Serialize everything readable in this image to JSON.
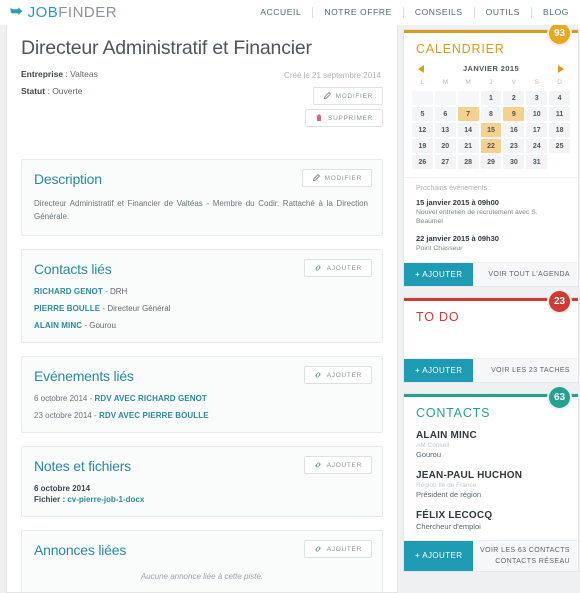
{
  "header": {
    "logo": {
      "mark_icon": "swoosh-icon",
      "part1": "JOB",
      "part2": "FINDER"
    },
    "nav": [
      {
        "label": "ACCUEIL"
      },
      {
        "label": "NOTRE OFFRE"
      },
      {
        "label": "CONSEILS"
      },
      {
        "label": "OUTILS"
      },
      {
        "label": "BLOG"
      }
    ]
  },
  "job": {
    "title": "Directeur Administratif et Financier",
    "entreprise_label": "Entreprise",
    "entreprise_value": "Valteas",
    "statut_label": "Statut",
    "statut_value": "Ouverte",
    "created": "Créé le 21 septembre 2014",
    "edit_button": "MODIFIER",
    "delete_button": "SUPPRIMER",
    "edit_icon": "pencil-icon",
    "delete_icon": "trash-icon"
  },
  "panels": {
    "description": {
      "title": "Description",
      "button": "MODIFIER",
      "button_icon": "pencil-icon",
      "text": "Directeur Administratif et Financier de Valtéas - Membre du Codir. Rattaché à la Direction Générale."
    },
    "contacts": {
      "title": "Contacts liés",
      "button": "AJOUTER",
      "button_icon": "link-icon",
      "items": [
        {
          "name": "RICHARD GENOT",
          "role": "DRH"
        },
        {
          "name": "PIERRE BOULLE",
          "role": "Directeur Général"
        },
        {
          "name": "ALAIN MINC",
          "role": "Gourou"
        }
      ]
    },
    "events": {
      "title": "Evénements liés",
      "button": "AJOUTER",
      "button_icon": "link-icon",
      "items": [
        {
          "date": "6 octobre 2014",
          "label": "RDV AVEC RICHARD GENOT"
        },
        {
          "date": "23 octobre 2014",
          "label": "RDV AVEC PIERRE BOULLE"
        }
      ]
    },
    "notes": {
      "title": "Notes et fichiers",
      "button": "AJOUTER",
      "button_icon": "link-icon",
      "date": "6 octobre 2014",
      "file_label": "Fichier :",
      "file_name": "cv-pierre-job-1-docx"
    },
    "annonces": {
      "title": "Annonces liées",
      "button": "AJOUTER",
      "button_icon": "link-icon",
      "empty": "Aucune annonce liée à cette piste."
    }
  },
  "sidebar": {
    "calendar": {
      "title": "CALENDRIER",
      "badge": "93",
      "accent": "#d79b1e",
      "month": "JANVIER 2015",
      "prev_icon": "chevron-left-icon",
      "next_icon": "chevron-right-icon",
      "dow": [
        "L",
        "M",
        "M",
        "J",
        "V",
        "S",
        "D"
      ],
      "leading_blanks": 3,
      "days": [
        1,
        2,
        3,
        4,
        5,
        6,
        7,
        8,
        9,
        10,
        11,
        12,
        13,
        14,
        15,
        16,
        17,
        18,
        19,
        20,
        21,
        22,
        23,
        24,
        25,
        26,
        27,
        28,
        29,
        30,
        31
      ],
      "highlighted": [
        7,
        9,
        15,
        22
      ],
      "next_events_label": "Prochains évènements :",
      "events": [
        {
          "when": "15 janvier 2015 à 09h00",
          "what": "Nouvel entretien de recrutement avec S. Beaumel"
        },
        {
          "when": "22 janvier 2015 à 09h30",
          "what": "Point Chasseur"
        }
      ],
      "add_button": "+ AJOUTER",
      "links": [
        "VOIR TOUT L'AGENDA"
      ]
    },
    "todo": {
      "title": "TO DO",
      "badge": "23",
      "accent": "#cf3a32",
      "add_button": "+ AJOUTER",
      "links": [
        "VOIR LES 23 TACHES"
      ]
    },
    "contacts": {
      "title": "CONTACTS",
      "badge": "63",
      "accent": "#25a28f",
      "items": [
        {
          "name": "ALAIN MINC",
          "org": "AM Conseil",
          "role": "Gourou"
        },
        {
          "name": "JEAN-PAUL HUCHON",
          "org": "Région Ile de France",
          "role": "Président de région"
        },
        {
          "name": "FÉLIX LECOCQ",
          "org": "",
          "role": "Chercheur d'emploi"
        }
      ],
      "add_button": "+ AJOUTER",
      "links": [
        "VOIR LES 63 CONTACTS",
        "CONTACTS RÉSEAU"
      ]
    }
  }
}
